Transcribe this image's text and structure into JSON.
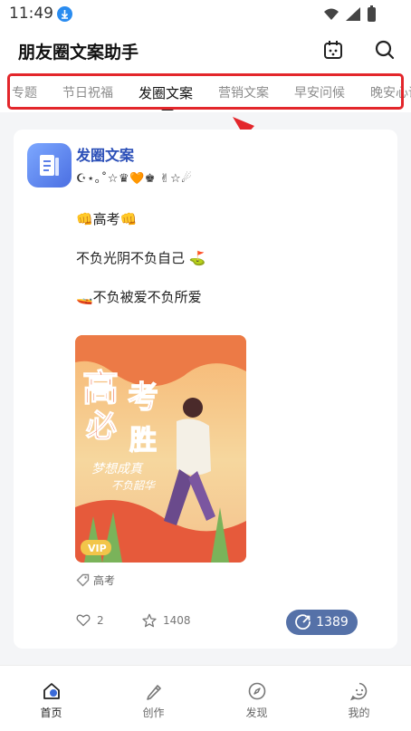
{
  "status_bar": {
    "time": "11:49"
  },
  "header": {
    "title": "朋友圈文案助手"
  },
  "tabs": [
    "专题",
    "节日祝福",
    "发圈文案",
    "营销文案",
    "早安问候",
    "晚安心语"
  ],
  "active_tab": 2,
  "post": {
    "author": "发圈文案",
    "signature": "☪⋆｡˚☆♛🧡♚ ✌☆☄",
    "lines": [
      "👊高考👊",
      "不负光阴不负自己 ⛳",
      "🚤不负被爱不负所爱"
    ],
    "poster": {
      "title_chars": [
        "高",
        "考",
        "必",
        "胜"
      ],
      "sub_line_1": "梦想成真",
      "sub_line_2": "不负韶华",
      "badge": "VIP"
    },
    "tag": "高考",
    "likes": "2",
    "favorites": "1408",
    "shares": "1389"
  },
  "nav": [
    "首页",
    "创作",
    "发现",
    "我的"
  ],
  "colors": {
    "accent": "#2b4fb8",
    "share_button": "#5571a8",
    "highlight": "#e3262b"
  }
}
